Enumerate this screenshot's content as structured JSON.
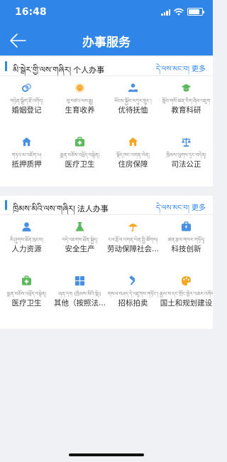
{
  "status": {
    "time": "16:48"
  },
  "nav": {
    "title": "办事服务"
  },
  "sections": [
    {
      "title_bo": "མི་སྒེར་གྱི་ལས་གཞིར།",
      "title_zh": "个人办事",
      "more_bo": "དེ་ལས་མང་བ།",
      "more_zh": "更多",
      "items": [
        {
          "bo": "གཉེན་སྒྲིག་ཐོ་འགོད།",
          "zh": "婚姻登记",
          "icon": "marriage-icon",
          "color": "#4a90e2"
        },
        {
          "bo": "བུ་བཙའ་ལས་རྒྱུ།",
          "zh": "生育收养",
          "icon": "baby-icon",
          "color": "#f5a623"
        },
        {
          "bo": "ཕོངས་སྐྱོབ་བཀུར་སྲུང་།",
          "zh": "优待抚恤",
          "icon": "care-icon",
          "color": "#4a90e2"
        },
        {
          "bo": "སློབ་གསོ་ཚན་རིག་ཞིབ་འཇུག",
          "zh": "教育科研",
          "icon": "graduation-cap-icon",
          "color": "#5cb85c"
        },
        {
          "bo": "གཏའ་མ་འཇོག་པ།",
          "zh": "抵押质押",
          "icon": "home-icon",
          "color": "#4a90e2"
        },
        {
          "bo": "སྨན་བཅོས་འཕྲོད་བསྟེན།",
          "zh": "医疗卫生",
          "icon": "medical-kit-icon",
          "color": "#5cb85c"
        },
        {
          "bo": "སྡོད་ཁང་འགན་ལེན།",
          "zh": "住房保障",
          "icon": "house-icon",
          "color": "#f5a623"
        },
        {
          "bo": "ཁྲིམས་ལུགས་དྲང་བདེན།",
          "zh": "司法公正",
          "icon": "justice-scale-icon",
          "color": "#4a90e2"
        }
      ]
    },
    {
      "title_bo": "ཁྲིམས་མིའི་ལས་གཞིར།",
      "title_zh": "法人办事",
      "more_bo": "དེ་ལས་མང་བ།",
      "more_zh": "更多",
      "items": [
        {
          "bo": "མི་ཤུགས་ཐོན་ཁུངས།",
          "zh": "人力资源",
          "icon": "person-icon",
          "color": "#4a90e2"
        },
        {
          "bo": "བདེ་འཇགས་ཐོན་སྐྱེད།",
          "zh": "安全生产",
          "icon": "flask-icon",
          "color": "#5cb85c"
        },
        {
          "bo": "ངལ་རྩོལ་འགན་ལེན་སྤྱི་ཚོགས།",
          "zh": "劳动保障社会...",
          "icon": "umbrella-icon",
          "color": "#f5a623"
        },
        {
          "bo": "ཚན་རྩལ་གསར་གཏོད།",
          "zh": "科技创新",
          "icon": "briefcase-icon",
          "color": "#4a90e2"
        },
        {
          "bo": "སྨན་བཅོས་འཕྲོད་བསྟེན།",
          "zh": "医疗卫生",
          "icon": "medical-kit-icon",
          "color": "#5cb85c"
        },
        {
          "bo": "ཞན་དག (ཁྲིམས་མིའི་སྡེ།)",
          "zh": "其他（按照法...",
          "icon": "grid-icon",
          "color": "#4a90e2"
        },
        {
          "bo": "གསལ་བཤད་དེ་འཛུགས་གཏོང་།",
          "zh": "招标拍卖",
          "icon": "hammer-icon",
          "color": "#4a90e2"
        },
        {
          "bo": "རྒྱལ་ས་དང་གྲོང་ཁྱེར་འཆར་འགོད།",
          "zh": "国土和规划建设",
          "icon": "palette-icon",
          "color": "#f5a623"
        }
      ]
    }
  ]
}
